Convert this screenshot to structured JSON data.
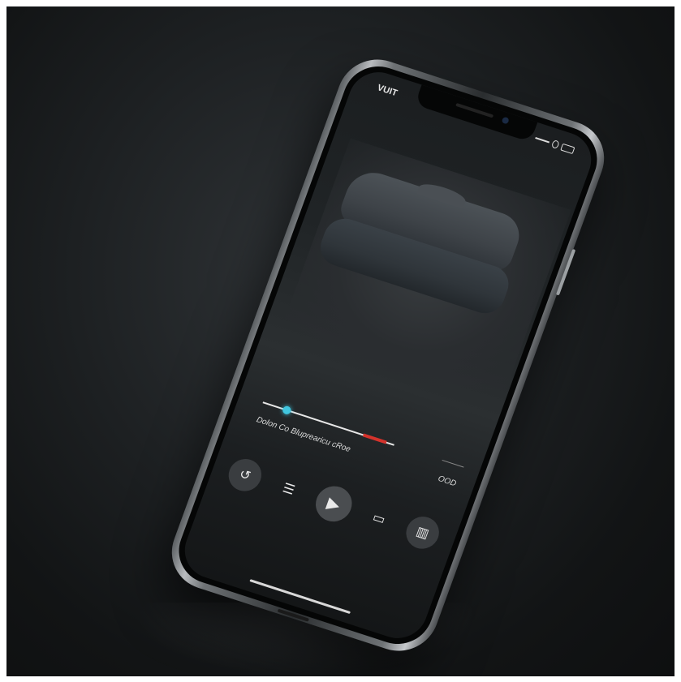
{
  "status": {
    "time": "VUIT"
  },
  "player": {
    "caption": "Dolon Co Bluprearicu cRoe",
    "duration": "OOD",
    "progress": 0.18,
    "buffered_marker": 0.85
  },
  "controls": [
    {
      "icon": "share-icon",
      "glyph": "↺"
    },
    {
      "icon": "list-icon",
      "glyph": "☰"
    },
    {
      "icon": "play-icon",
      "glyph": "▶"
    },
    {
      "icon": "cast-icon",
      "glyph": "▭"
    },
    {
      "icon": "book-icon",
      "glyph": "▥"
    }
  ],
  "colors": {
    "accent": "#41c7e0",
    "progress_red": "#d5332c",
    "background": "#1b1e20"
  }
}
